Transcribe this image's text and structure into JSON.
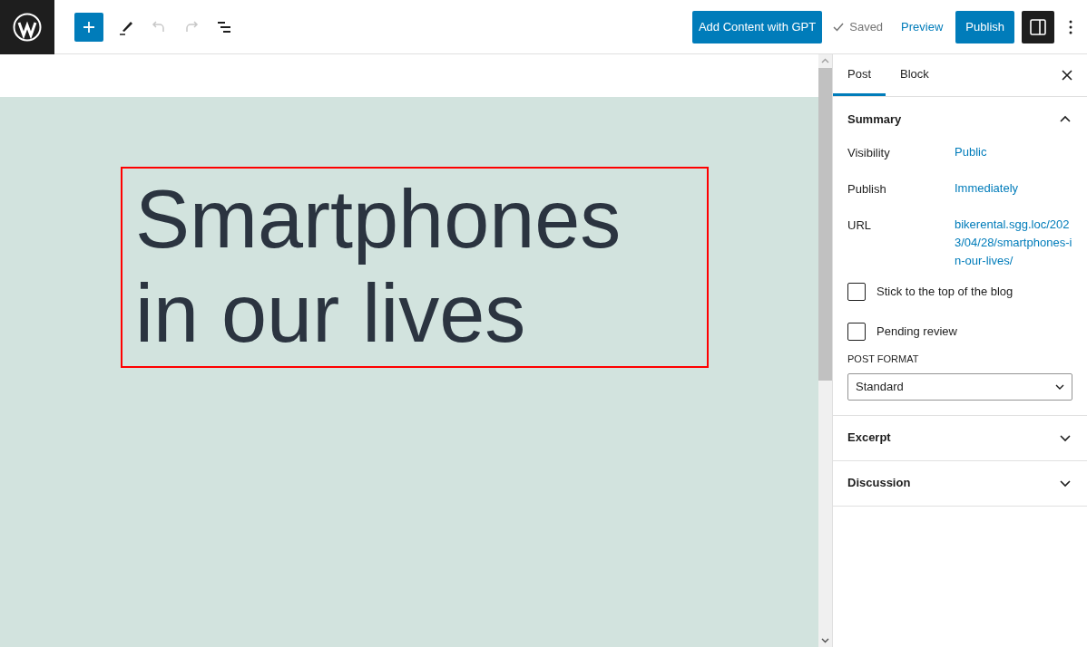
{
  "toolbar": {
    "tools": [
      {
        "kind": "add",
        "disabled": false
      },
      {
        "kind": "edit",
        "disabled": false
      },
      {
        "kind": "undo",
        "disabled": true
      },
      {
        "kind": "redo",
        "disabled": true
      },
      {
        "kind": "outline",
        "disabled": false
      }
    ],
    "gpt_button": "Add Content with GPT",
    "saved": "Saved",
    "preview": "Preview",
    "publish": "Publish",
    "settings_pressed": true
  },
  "title": "Smartphones in our lives",
  "sidebar": {
    "tabs": [
      {
        "label": "Post",
        "selected": true
      },
      {
        "label": "Block",
        "selected": false
      }
    ],
    "panels": [
      {
        "kind": "summary",
        "title": "Summary",
        "expanded": true,
        "rows": [
          {
            "label": "Visibility",
            "value": "Public"
          },
          {
            "label": "Publish",
            "value": "Immediately"
          },
          {
            "label": "URL",
            "value": "bikerental.sgg.loc/2023/04/28/smartphones-in-our-lives/"
          }
        ],
        "checkboxes": [
          {
            "label": "Stick to the top of the blog",
            "checked": false
          },
          {
            "label": "Pending review",
            "checked": false
          }
        ],
        "format_label": "POST FORMAT",
        "format_value": "Standard"
      },
      {
        "kind": "plain",
        "title": "Excerpt",
        "expanded": false
      },
      {
        "kind": "plain",
        "title": "Discussion",
        "expanded": false
      }
    ]
  }
}
